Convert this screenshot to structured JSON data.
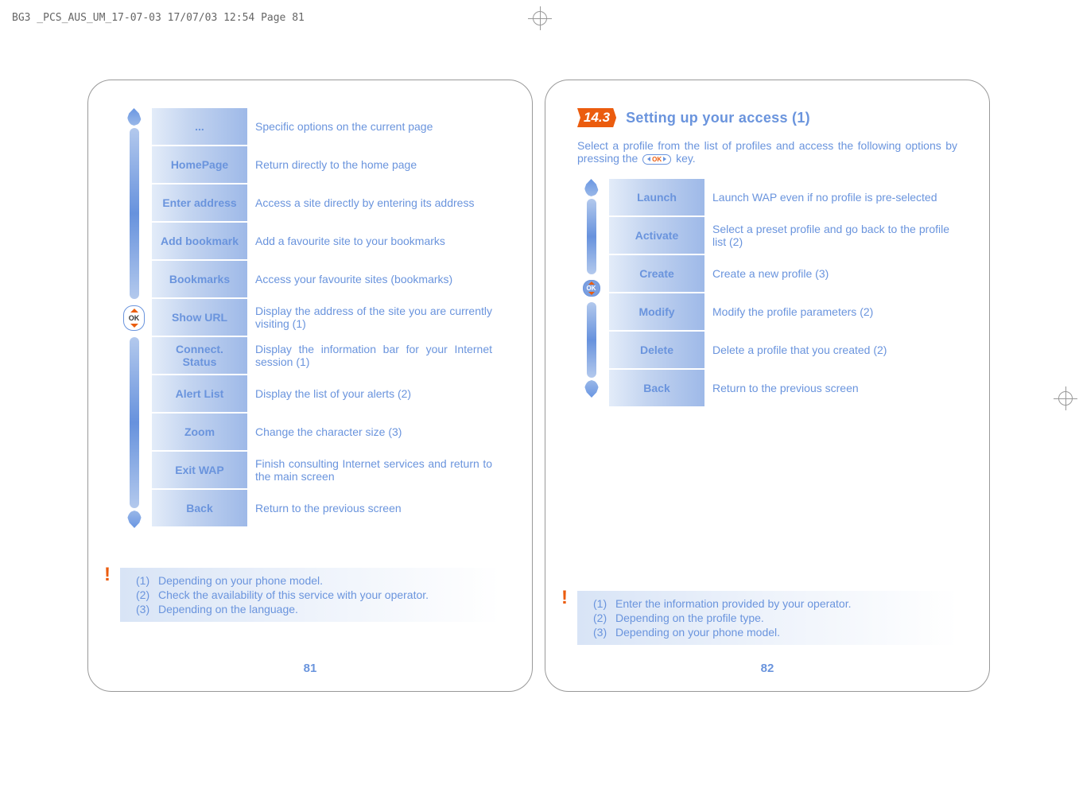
{
  "header": "BG3 _PCS_AUS_UM_17-07-03  17/07/03  12:54  Page 81",
  "left": {
    "rows": [
      {
        "label": "...",
        "desc": "Specific options on the current page"
      },
      {
        "label": "HomePage",
        "desc": "Return directly to the home page"
      },
      {
        "label": "Enter address",
        "desc": "Access a site directly by entering its address"
      },
      {
        "label": "Add bookmark",
        "desc": "Add a favourite site to your bookmarks"
      },
      {
        "label": "Bookmarks",
        "desc": "Access your favourite sites (bookmarks)"
      },
      {
        "label": "Show URL",
        "desc": "Display the address of the site you are currently visiting (1)"
      },
      {
        "label": "Connect. Status",
        "desc": "Display the information bar for your Internet session (1)"
      },
      {
        "label": "Alert List",
        "desc": "Display the list of your alerts (2)"
      },
      {
        "label": "Zoom",
        "desc": "Change the character size (3)"
      },
      {
        "label": "Exit WAP",
        "desc": "Finish consulting Internet services and return to the main screen"
      },
      {
        "label": "Back",
        "desc": "Return to the previous screen"
      }
    ],
    "footnotes": [
      {
        "num": "(1)",
        "text": "Depending on your phone model."
      },
      {
        "num": "(2)",
        "text": "Check the availability of this service with your operator."
      },
      {
        "num": "(3)",
        "text": "Depending on the language."
      }
    ],
    "pageNum": "81"
  },
  "right": {
    "sectionNum": "14.3",
    "sectionTitle": "Setting up your access (1)",
    "introBefore": "Select a profile from the list of profiles and access the following options by pressing the ",
    "introAfter": " key.",
    "rows": [
      {
        "label": "Launch",
        "desc": "Launch WAP even if no profile is pre-selected"
      },
      {
        "label": "Activate",
        "desc": "Select a preset profile and go back to the profile list (2)"
      },
      {
        "label": "Create",
        "desc": "Create a new profile (3)"
      },
      {
        "label": "Modify",
        "desc": "Modify the profile parameters (2)"
      },
      {
        "label": "Delete",
        "desc": "Delete a profile that you created (2)"
      },
      {
        "label": "Back",
        "desc": "Return to the previous screen"
      }
    ],
    "footnotes": [
      {
        "num": "(1)",
        "text": "Enter the information provided by your operator."
      },
      {
        "num": "(2)",
        "text": "Depending on the profile type."
      },
      {
        "num": "(3)",
        "text": "Depending on your phone model."
      }
    ],
    "pageNum": "82"
  },
  "ok": "OK"
}
